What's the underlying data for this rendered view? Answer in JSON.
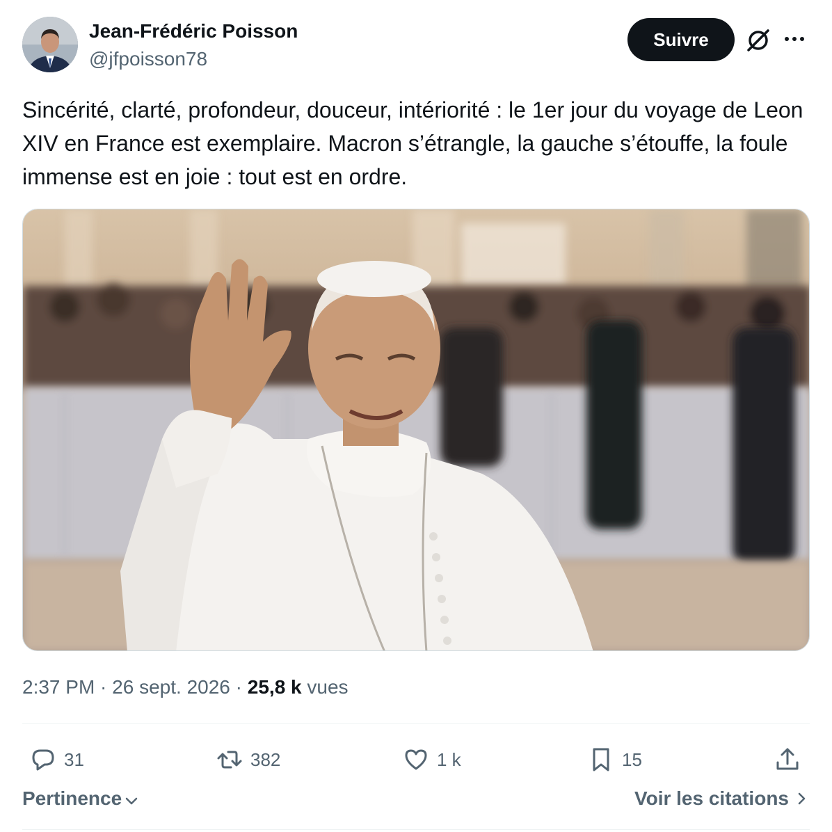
{
  "author": {
    "name": "Jean-Frédéric Poisson",
    "handle": "@jfpoisson78"
  },
  "header": {
    "follow_label": "Suivre",
    "icons": [
      "grok-icon",
      "more-icon"
    ]
  },
  "tweet": {
    "text": "Sincérité, clarté, profondeur, douceur, intériorité : le 1er jour du voyage de Leon XIV en France est exemplaire. Macron s’étrangle, la gauche s’étouffe, la foule immense est en joie : tout est en ordre."
  },
  "meta": {
    "time": "2:37 PM",
    "separator": " · ",
    "date": "26 sept. 2026",
    "views_count": "25,8 k",
    "views_label": "vues"
  },
  "actions": {
    "replies": "31",
    "reposts": "382",
    "likes": "1 k",
    "bookmarks": "15"
  },
  "footer": {
    "sort_label": "Pertinence",
    "quotes_label": "Voir les citations"
  },
  "colors": {
    "text": "#0f1419",
    "secondary": "#536471",
    "button_bg": "#0f1419",
    "divider": "#eff3f4"
  }
}
